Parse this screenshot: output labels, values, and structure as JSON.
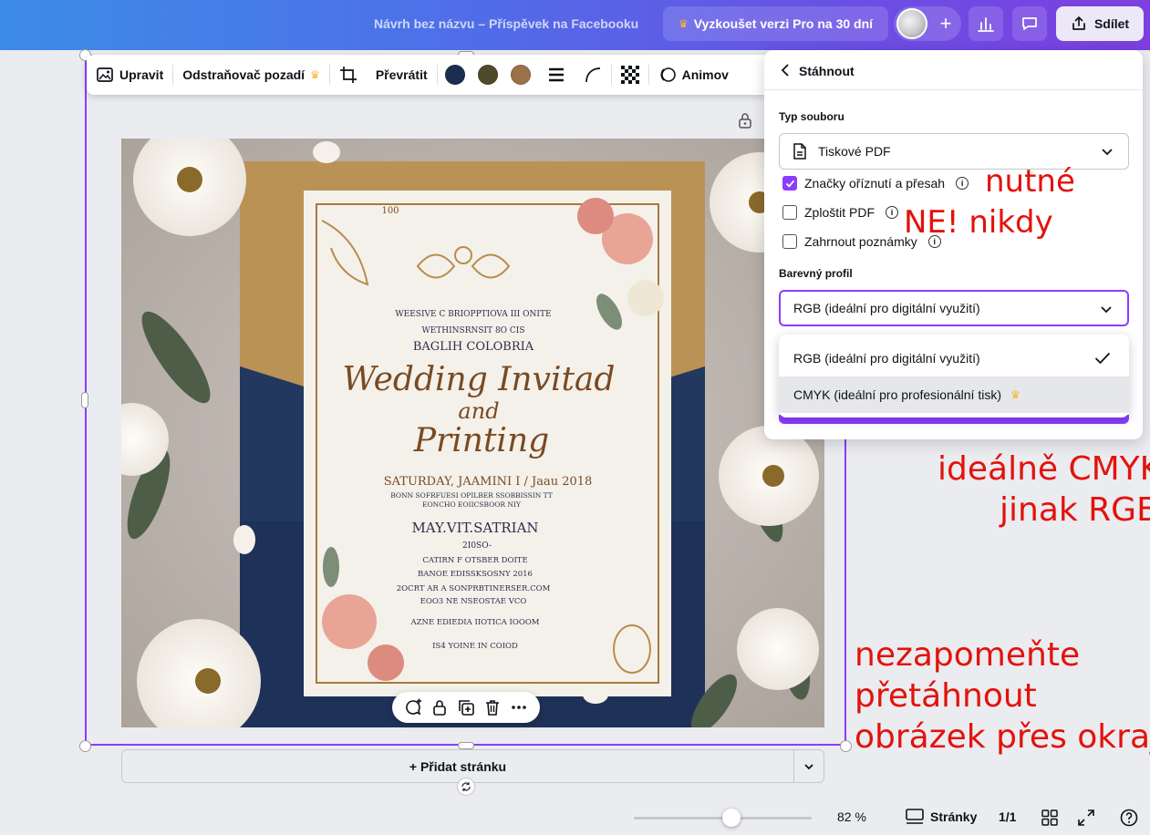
{
  "header": {
    "doc_title": "Návrh bez názvu – Příspěvek na Facebooku",
    "pro_button": "Vyzkoušet verzi Pro na 30 dní",
    "share_button": "Sdílet"
  },
  "toolbar": {
    "edit": "Upravit",
    "bg_remover": "Odstraňovač pozadí",
    "flip": "Převrátit",
    "animate": "Animov",
    "swatches": [
      "#1c2e4f",
      "#4e4a2a",
      "#9b7149"
    ]
  },
  "invitation": {
    "top_small_1": "WEESIVE C BRIOPPTIOVA III ONITE",
    "top_small_2": "WETHINSRNSIT 8O CIS",
    "top_name": "BAGLIH COLOBRIA",
    "script_1": "Wedding Invitad",
    "script_2": "and",
    "script_3": "Printing",
    "date": "SATURDAY, JAAMINI I / Jaau 2018",
    "mid_small_1": "BONN SOFRFUESI OPILBER SSOBBISSIN TT",
    "mid_small_2": "EONCHO EOIICSBOOR NIY",
    "names": "MAY.VIT.SATRIAN",
    "year": "2I0SO-",
    "line_a": "CATIRN F OTSBER DOITE",
    "line_b": "BANOE EDISSKSOSNY 2016",
    "line_c": "2OCRT AR A SONPRBTINERSER.COM",
    "line_d": "EOO3 NE NSEOSTAE VCO",
    "line_e": "AZNE EDIEDIA IIOTICA IOOOM",
    "line_f": "IS4 YOINE IN COIOD",
    "corner_number": "100"
  },
  "canvas": {
    "add_page": "+ Přidat stránku"
  },
  "footer": {
    "zoom": "82 %",
    "zoom_fraction": 0.55,
    "pages_label": "Stránky",
    "page_count": "1/1"
  },
  "panel": {
    "title": "Stáhnout",
    "file_type_label": "Typ souboru",
    "file_type_value": "Tiskové PDF",
    "options": [
      {
        "label": "Značky oříznutí a přesah",
        "checked": true
      },
      {
        "label": "Zploštit PDF",
        "checked": false
      },
      {
        "label": "Zahrnout poznámky",
        "checked": false
      }
    ],
    "color_profile_label": "Barevný profil",
    "color_profile_value": "RGB (ideální pro digitální využití)",
    "dropdown_options": [
      {
        "label": "RGB (ideální pro digitální využití)",
        "selected": true
      },
      {
        "label": "CMYK (ideální pro profesionální tisk)",
        "pro": true
      }
    ]
  },
  "annotations": {
    "nutne": "nutné",
    "nikdy": "NE! nikdy",
    "cmyk_1": "ideálně CMYK",
    "cmyk_2": "jinak RGB",
    "drag_1": "nezapomeňte",
    "drag_2": "přetáhnout",
    "drag_3": "obrázek přes okraj"
  },
  "colors": {
    "accent": "#8b3dff",
    "annotation": "#e3120b",
    "crown": "#f7b731"
  }
}
